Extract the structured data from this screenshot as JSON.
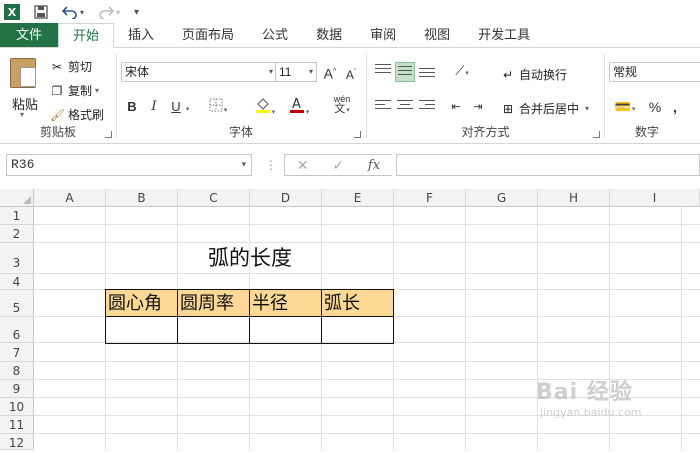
{
  "app": {
    "logo": "X"
  },
  "tabs": [
    {
      "label": "文件"
    },
    {
      "label": "开始"
    },
    {
      "label": "插入"
    },
    {
      "label": "页面布局"
    },
    {
      "label": "公式"
    },
    {
      "label": "数据"
    },
    {
      "label": "审阅"
    },
    {
      "label": "视图"
    },
    {
      "label": "开发工具"
    }
  ],
  "clipboard": {
    "paste": "粘贴",
    "cut": "剪切",
    "copy": "复制",
    "format_painter": "格式刷",
    "label": "剪贴板"
  },
  "font": {
    "name": "宋体",
    "size": "11",
    "bold": "B",
    "italic": "I",
    "underline": "U",
    "phonetic": "wén",
    "label": "字体"
  },
  "alignment": {
    "wrap_text": "自动换行",
    "merge_center": "合并后居中",
    "label": "对齐方式"
  },
  "number": {
    "format": "常规",
    "percent": "%",
    "comma": ",",
    "label": "数字"
  },
  "formula_bar": {
    "name_box": "R36",
    "cancel": "✕",
    "enter": "✓",
    "fx": "fx",
    "content": ""
  },
  "columns": [
    "A",
    "B",
    "C",
    "D",
    "E",
    "F",
    "G",
    "H",
    "I"
  ],
  "rows": [
    "1",
    "2",
    "3",
    "4",
    "5",
    "6",
    "7",
    "8",
    "9",
    "10",
    "11",
    "12"
  ],
  "sheet": {
    "title": "弧的长度",
    "headers": [
      "圆心角",
      "圆周率",
      "半径",
      "弧长"
    ],
    "values": [
      "",
      "",
      "",
      ""
    ],
    "header_fill": "#fbd995"
  },
  "colors": {
    "brand": "#217346",
    "font_color": "#c00000",
    "fill_color": "#ffff00"
  },
  "watermark": {
    "brand": "Bai 经验",
    "url": "jingyan.baidu.com"
  }
}
